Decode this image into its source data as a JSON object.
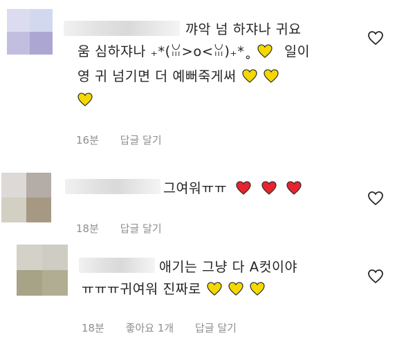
{
  "comments": [
    {
      "lines": [
        "꺄악 넘 하쟈나 귀요",
        "움 심하쟈나 ₊*(ꈍ>o<ꈍ)₊*˳",
        "영 귀 넘기면 더 예뻐죽게써"
      ],
      "meta": {
        "time": "16분",
        "reply": "답글 달기"
      },
      "hearts": {
        "line2": 1,
        "line3": 2,
        "line4": 1,
        "color": "#f5d800"
      }
    },
    {
      "lines": [
        "그여워ㅠㅠ"
      ],
      "suffix_line2": "일이",
      "meta": {
        "time": "18분",
        "reply": "답글 달기"
      },
      "hearts": {
        "line1": 3,
        "color": "#e8232e"
      }
    },
    {
      "lines": [
        "애기는 그냥 다 A컷이야",
        "ㅠㅠㅠ귀여워 진짜로"
      ],
      "meta": {
        "time": "18분",
        "likes": "좋아요 1개",
        "reply": "답글 달기"
      },
      "hearts": {
        "line2": 3,
        "color": "#f5d800"
      }
    }
  ],
  "icons": {
    "like": "heart-outline-icon",
    "yellow_heart": "yellow-heart-emoji",
    "red_heart": "red-heart-emoji"
  }
}
